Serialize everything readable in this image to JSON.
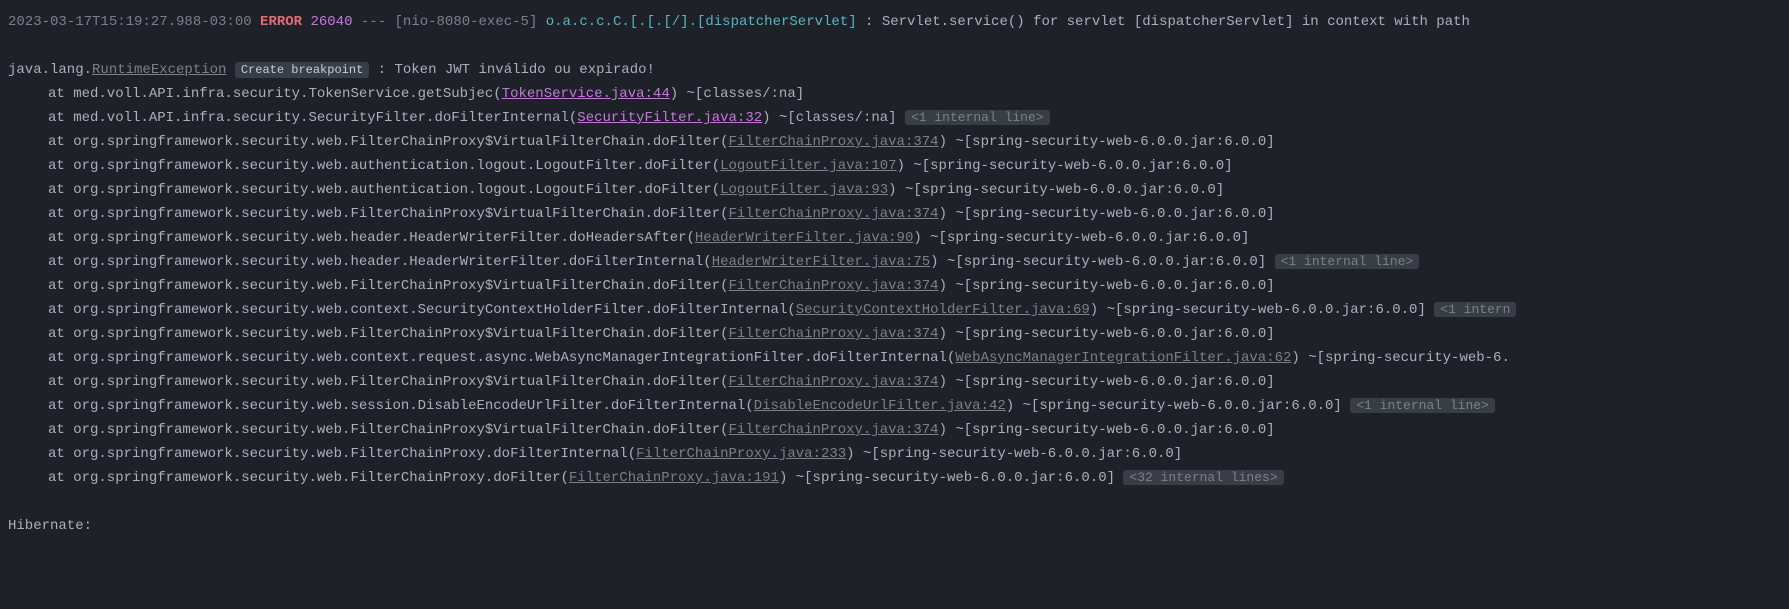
{
  "header": {
    "timestamp": "2023-03-17T15:19:27.988-03:00",
    "level": "ERROR",
    "pid": "26040",
    "dashes": "---",
    "thread": "[nio-8080-exec-5]",
    "logger": "o.a.c.c.C.[.[.[/].[dispatcherServlet]",
    "message": ": Servlet.service() for servlet [dispatcherServlet] in context with path "
  },
  "exception": {
    "prefix": "java.lang.",
    "class": "RuntimeException",
    "breakpoint_label": "Create breakpoint",
    "message": ": Token JWT inválido ou expirado!"
  },
  "frames": [
    {
      "at": "at med.voll.API.infra.security.TokenService.getSubjec(",
      "link": "TokenService.java:44",
      "link_style": "p",
      "after": ") ~[classes/:na]",
      "internal": ""
    },
    {
      "at": "at med.voll.API.infra.security.SecurityFilter.doFilterInternal(",
      "link": "SecurityFilter.java:32",
      "link_style": "p",
      "after": ") ~[classes/:na]",
      "internal": "<1 internal line>"
    },
    {
      "at": "at org.springframework.security.web.FilterChainProxy$VirtualFilterChain.doFilter(",
      "link": "FilterChainProxy.java:374",
      "link_style": "g",
      "after": ") ~[spring-security-web-6.0.0.jar:6.0.0]",
      "internal": ""
    },
    {
      "at": "at org.springframework.security.web.authentication.logout.LogoutFilter.doFilter(",
      "link": "LogoutFilter.java:107",
      "link_style": "g",
      "after": ") ~[spring-security-web-6.0.0.jar:6.0.0]",
      "internal": ""
    },
    {
      "at": "at org.springframework.security.web.authentication.logout.LogoutFilter.doFilter(",
      "link": "LogoutFilter.java:93",
      "link_style": "g",
      "after": ") ~[spring-security-web-6.0.0.jar:6.0.0]",
      "internal": ""
    },
    {
      "at": "at org.springframework.security.web.FilterChainProxy$VirtualFilterChain.doFilter(",
      "link": "FilterChainProxy.java:374",
      "link_style": "g",
      "after": ") ~[spring-security-web-6.0.0.jar:6.0.0]",
      "internal": ""
    },
    {
      "at": "at org.springframework.security.web.header.HeaderWriterFilter.doHeadersAfter(",
      "link": "HeaderWriterFilter.java:90",
      "link_style": "g",
      "after": ") ~[spring-security-web-6.0.0.jar:6.0.0]",
      "internal": ""
    },
    {
      "at": "at org.springframework.security.web.header.HeaderWriterFilter.doFilterInternal(",
      "link": "HeaderWriterFilter.java:75",
      "link_style": "g",
      "after": ") ~[spring-security-web-6.0.0.jar:6.0.0]",
      "internal": "<1 internal line>"
    },
    {
      "at": "at org.springframework.security.web.FilterChainProxy$VirtualFilterChain.doFilter(",
      "link": "FilterChainProxy.java:374",
      "link_style": "g",
      "after": ") ~[spring-security-web-6.0.0.jar:6.0.0]",
      "internal": ""
    },
    {
      "at": "at org.springframework.security.web.context.SecurityContextHolderFilter.doFilterInternal(",
      "link": "SecurityContextHolderFilter.java:69",
      "link_style": "g",
      "after": ") ~[spring-security-web-6.0.0.jar:6.0.0]",
      "internal": "<1 intern"
    },
    {
      "at": "at org.springframework.security.web.FilterChainProxy$VirtualFilterChain.doFilter(",
      "link": "FilterChainProxy.java:374",
      "link_style": "g",
      "after": ") ~[spring-security-web-6.0.0.jar:6.0.0]",
      "internal": ""
    },
    {
      "at": "at org.springframework.security.web.context.request.async.WebAsyncManagerIntegrationFilter.doFilterInternal(",
      "link": "WebAsyncManagerIntegrationFilter.java:62",
      "link_style": "g",
      "after": ") ~[spring-security-web-6.",
      "internal": ""
    },
    {
      "at": "at org.springframework.security.web.FilterChainProxy$VirtualFilterChain.doFilter(",
      "link": "FilterChainProxy.java:374",
      "link_style": "g",
      "after": ") ~[spring-security-web-6.0.0.jar:6.0.0]",
      "internal": ""
    },
    {
      "at": "at org.springframework.security.web.session.DisableEncodeUrlFilter.doFilterInternal(",
      "link": "DisableEncodeUrlFilter.java:42",
      "link_style": "g",
      "after": ") ~[spring-security-web-6.0.0.jar:6.0.0]",
      "internal": "<1 internal line>"
    },
    {
      "at": "at org.springframework.security.web.FilterChainProxy$VirtualFilterChain.doFilter(",
      "link": "FilterChainProxy.java:374",
      "link_style": "g",
      "after": ") ~[spring-security-web-6.0.0.jar:6.0.0]",
      "internal": ""
    },
    {
      "at": "at org.springframework.security.web.FilterChainProxy.doFilterInternal(",
      "link": "FilterChainProxy.java:233",
      "link_style": "g",
      "after": ") ~[spring-security-web-6.0.0.jar:6.0.0]",
      "internal": ""
    },
    {
      "at": "at org.springframework.security.web.FilterChainProxy.doFilter(",
      "link": "FilterChainProxy.java:191",
      "link_style": "g",
      "after": ") ~[spring-security-web-6.0.0.jar:6.0.0]",
      "internal": "<32 internal lines>"
    }
  ],
  "footer": {
    "hibernate": "Hibernate:"
  }
}
